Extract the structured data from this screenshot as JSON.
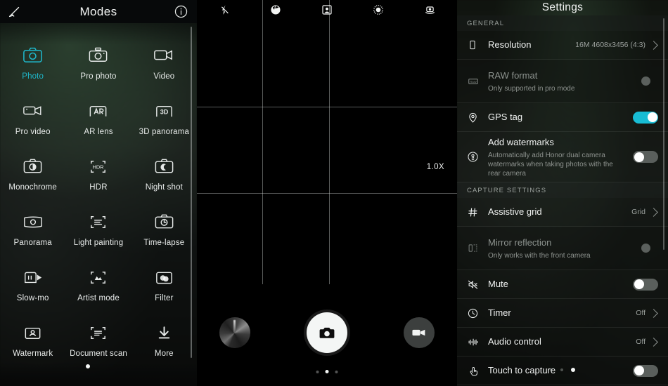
{
  "modes_panel": {
    "title": "Modes",
    "edit_icon": "pencil-edit-icon",
    "info_icon": "info-circle-icon",
    "active_mode": "Photo",
    "items": [
      {
        "label": "Photo",
        "icon": "camera-outline-icon",
        "active": true
      },
      {
        "label": "Pro photo",
        "icon": "pro-camera-icon",
        "active": false
      },
      {
        "label": "Video",
        "icon": "video-camera-icon",
        "active": false
      },
      {
        "label": "Pro video",
        "icon": "pro-video-icon",
        "active": false
      },
      {
        "label": "AR lens",
        "icon": "ar-lens-icon",
        "active": false
      },
      {
        "label": "3D panorama",
        "icon": "3d-panorama-icon",
        "active": false
      },
      {
        "label": "Monochrome",
        "icon": "monochrome-icon",
        "active": false
      },
      {
        "label": "HDR",
        "icon": "hdr-icon",
        "active": false
      },
      {
        "label": "Night shot",
        "icon": "night-shot-icon",
        "active": false
      },
      {
        "label": "Panorama",
        "icon": "panorama-icon",
        "active": false
      },
      {
        "label": "Light painting",
        "icon": "light-painting-icon",
        "active": false
      },
      {
        "label": "Time-lapse",
        "icon": "time-lapse-icon",
        "active": false
      },
      {
        "label": "Slow-mo",
        "icon": "slow-mo-icon",
        "active": false
      },
      {
        "label": "Artist mode",
        "icon": "artist-mode-icon",
        "active": false
      },
      {
        "label": "Filter",
        "icon": "filter-icon",
        "active": false
      },
      {
        "label": "Watermark",
        "icon": "watermark-icon",
        "active": false
      },
      {
        "label": "Document scan",
        "icon": "document-scan-icon",
        "active": false
      },
      {
        "label": "More",
        "icon": "download-more-icon",
        "active": false
      }
    ]
  },
  "viewfinder": {
    "top_icons": [
      {
        "name": "flash-off-icon"
      },
      {
        "name": "aperture-icon"
      },
      {
        "name": "portrait-mode-icon"
      },
      {
        "name": "moving-picture-icon"
      },
      {
        "name": "settings-camera-icon"
      }
    ],
    "zoom_level": "1.0X",
    "gallery_thumb": "gallery-thumbnail",
    "shutter_icon": "camera-shutter-icon",
    "video_icon": "video-record-icon",
    "page_dots": {
      "count": 3,
      "active_index": 1
    }
  },
  "settings_panel": {
    "title": "Settings",
    "page_dots": {
      "count": 3,
      "active_index": 2
    },
    "sections": [
      {
        "heading": "GENERAL",
        "rows": [
          {
            "key": "resolution",
            "icon": "resolution-icon",
            "title": "Resolution",
            "subtitle": "",
            "value": "16M 4608x3456 (4:3)",
            "control": "chevron",
            "disabled": false
          },
          {
            "key": "raw-format",
            "icon": "raw-format-icon",
            "title": "RAW format",
            "subtitle": "Only supported in pro mode",
            "value": "",
            "control": "disabled-dot",
            "disabled": true
          },
          {
            "key": "gps-tag",
            "icon": "gps-pin-icon",
            "title": "GPS tag",
            "subtitle": "",
            "value": "",
            "control": "toggle-on",
            "disabled": false
          },
          {
            "key": "add-watermarks",
            "icon": "watermark-stamp-icon",
            "title": "Add watermarks",
            "subtitle": "Automatically add Honor dual camera watermarks when taking photos with the rear camera",
            "value": "",
            "control": "toggle-off",
            "disabled": false
          }
        ]
      },
      {
        "heading": "CAPTURE SETTINGS",
        "rows": [
          {
            "key": "assistive-grid",
            "icon": "grid-icon",
            "title": "Assistive grid",
            "subtitle": "",
            "value": "Grid",
            "control": "chevron",
            "disabled": false
          },
          {
            "key": "mirror-reflection",
            "icon": "mirror-icon",
            "title": "Mirror reflection",
            "subtitle": "Only works with the front camera",
            "value": "",
            "control": "disabled-dot",
            "disabled": true
          },
          {
            "key": "mute",
            "icon": "mute-icon",
            "title": "Mute",
            "subtitle": "",
            "value": "",
            "control": "toggle-off",
            "disabled": false
          },
          {
            "key": "timer",
            "icon": "clock-icon",
            "title": "Timer",
            "subtitle": "",
            "value": "Off",
            "control": "chevron",
            "disabled": false
          },
          {
            "key": "audio-control",
            "icon": "audio-wave-icon",
            "title": "Audio control",
            "subtitle": "",
            "value": "Off",
            "control": "chevron",
            "disabled": false
          },
          {
            "key": "touch-to-capture",
            "icon": "touch-hand-icon",
            "title": "Touch to capture",
            "subtitle": "",
            "value": "",
            "control": "toggle-off",
            "disabled": false
          }
        ]
      }
    ]
  },
  "colors": {
    "accent_cyan": "#18bcd4",
    "active_mode_text": "#1fb6c9",
    "panel_bg": "#0c0f0d",
    "text_primary": "#f0f2f1",
    "text_secondary": "#8e938f"
  }
}
